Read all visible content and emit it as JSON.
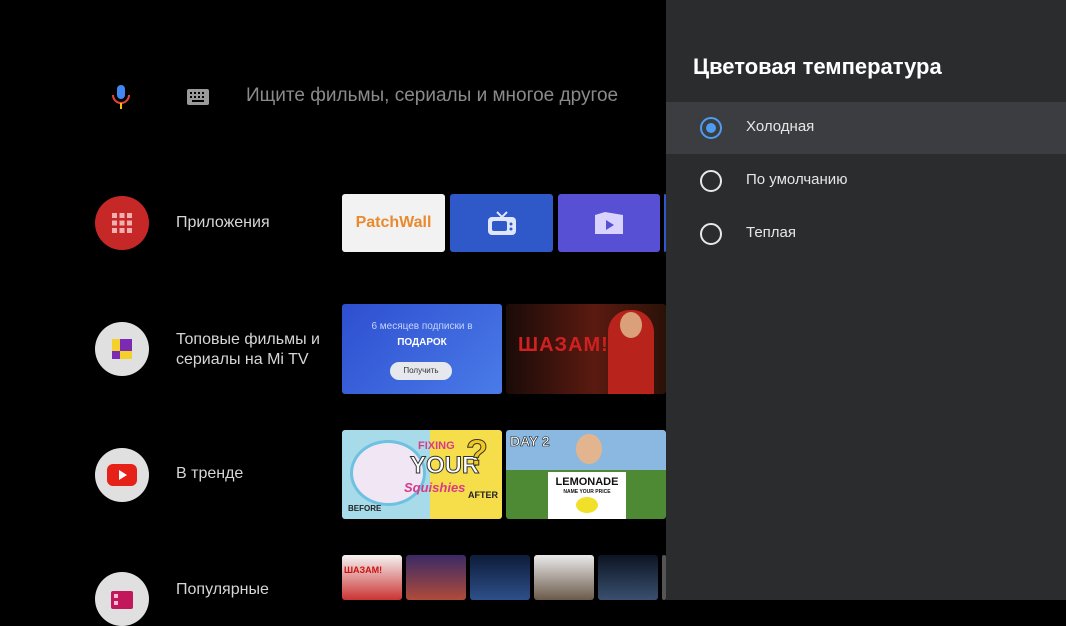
{
  "search": {
    "placeholder": "Ищите фильмы, сериалы и многое другое"
  },
  "rows": [
    {
      "label": "Приложения"
    },
    {
      "label": "Топовые фильмы и\nсериалы на Mi TV"
    },
    {
      "label": "В тренде"
    },
    {
      "label": "Популярные"
    }
  ],
  "apps": {
    "patchwall": "PatchWall"
  },
  "promo": {
    "line1": "6 месяцев подписки в",
    "line2": "ПОДАРОК",
    "button": "Получить",
    "movie": "ШАЗАМ!"
  },
  "trending": {
    "video1": {
      "top": "FIXING",
      "main": "YOUR",
      "script": "Squishies",
      "before": "BEFORE",
      "after": "AFTER"
    },
    "video2": {
      "day": "DAY 2",
      "sign": "LEMONADE",
      "sub": "NAME YOUR PRICE"
    }
  },
  "popular": {
    "poster1": "ШАЗАМ!"
  },
  "panel": {
    "title": "Цветовая температура",
    "options": [
      {
        "label": "Холодная",
        "selected": true
      },
      {
        "label": "По умолчанию",
        "selected": false
      },
      {
        "label": "Теплая",
        "selected": false
      }
    ]
  },
  "colors": {
    "accent": "#4c9cf0",
    "panel_bg": "#2b2c2e",
    "selected_bg": "#3c3d40"
  }
}
